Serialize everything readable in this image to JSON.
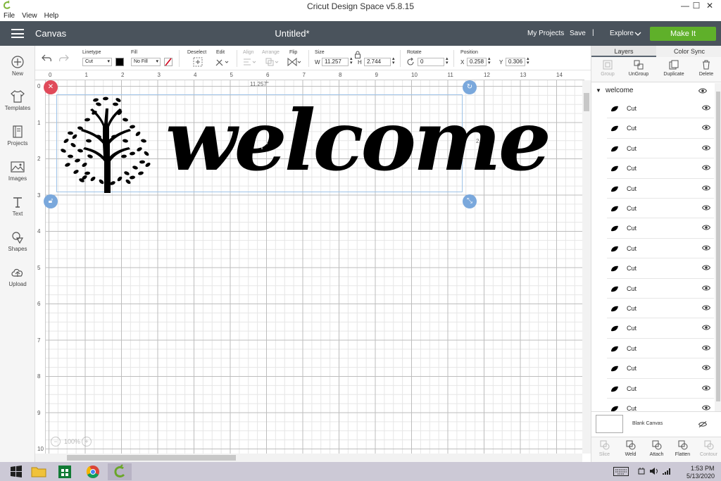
{
  "window": {
    "title": "Cricut Design Space  v5.8.15",
    "min": "—",
    "max": "☐",
    "close": "✕"
  },
  "menu": [
    "File",
    "View",
    "Help"
  ],
  "header": {
    "section": "Canvas",
    "doc_title": "Untitled*",
    "my_projects": "My Projects",
    "save": "Save",
    "separator": "|",
    "explore": "Explore",
    "make_it": "Make It"
  },
  "leftbar": [
    {
      "label": "New",
      "icon": "plus-circle-icon"
    },
    {
      "label": "Templates",
      "icon": "shirt-icon"
    },
    {
      "label": "Projects",
      "icon": "book-icon"
    },
    {
      "label": "Images",
      "icon": "image-icon"
    },
    {
      "label": "Text",
      "icon": "text-t-icon"
    },
    {
      "label": "Shapes",
      "icon": "shapes-icon"
    },
    {
      "label": "Upload",
      "icon": "upload-cloud-icon"
    }
  ],
  "editbar": {
    "linetype_label": "Linetype",
    "linetype_value": "Cut",
    "fill_label": "Fill",
    "fill_value": "No Fill",
    "deselect_label": "Deselect",
    "edit_label": "Edit",
    "align_label": "Align",
    "arrange_label": "Arrange",
    "flip_label": "Flip",
    "size_label": "Size",
    "w_label": "W",
    "w_value": "11.257",
    "h_label": "H",
    "h_value": "2.744",
    "rotate_label": "Rotate",
    "rotate_value": "0",
    "position_label": "Position",
    "x_label": "X",
    "x_value": "0.258",
    "y_label": "Y",
    "y_value": "0.306",
    "linetype_color": "#000000"
  },
  "canvas": {
    "ruler_top": [
      "0",
      "1",
      "2",
      "3",
      "4",
      "5",
      "6",
      "7",
      "8",
      "9",
      "10",
      "11",
      "12",
      "13",
      "14"
    ],
    "ruler_left": [
      "0",
      "1",
      "2",
      "3",
      "4",
      "5",
      "6",
      "7",
      "8",
      "9",
      "10"
    ],
    "width_dim": "11.257\"",
    "height_dim": "2.744\"",
    "design_text": "welcome",
    "zoom": "100%"
  },
  "panel": {
    "tabs": [
      "Layers",
      "Color Sync"
    ],
    "tools": [
      {
        "label": "Group",
        "enabled": false
      },
      {
        "label": "UnGroup",
        "enabled": true
      },
      {
        "label": "Duplicate",
        "enabled": true
      },
      {
        "label": "Delete",
        "enabled": true
      }
    ],
    "group_name": "welcome",
    "layers": [
      "Cut",
      "Cut",
      "Cut",
      "Cut",
      "Cut",
      "Cut",
      "Cut",
      "Cut",
      "Cut",
      "Cut",
      "Cut",
      "Cut",
      "Cut",
      "Cut",
      "Cut",
      "Cut"
    ],
    "blank_canvas": "Blank Canvas",
    "bottom_tools": [
      {
        "label": "Slice",
        "enabled": false
      },
      {
        "label": "Weld",
        "enabled": true
      },
      {
        "label": "Attach",
        "enabled": true
      },
      {
        "label": "Flatten",
        "enabled": true
      },
      {
        "label": "Contour",
        "enabled": false
      }
    ]
  },
  "taskbar": {
    "time": "1:53 PM",
    "date": "5/13/2020"
  }
}
